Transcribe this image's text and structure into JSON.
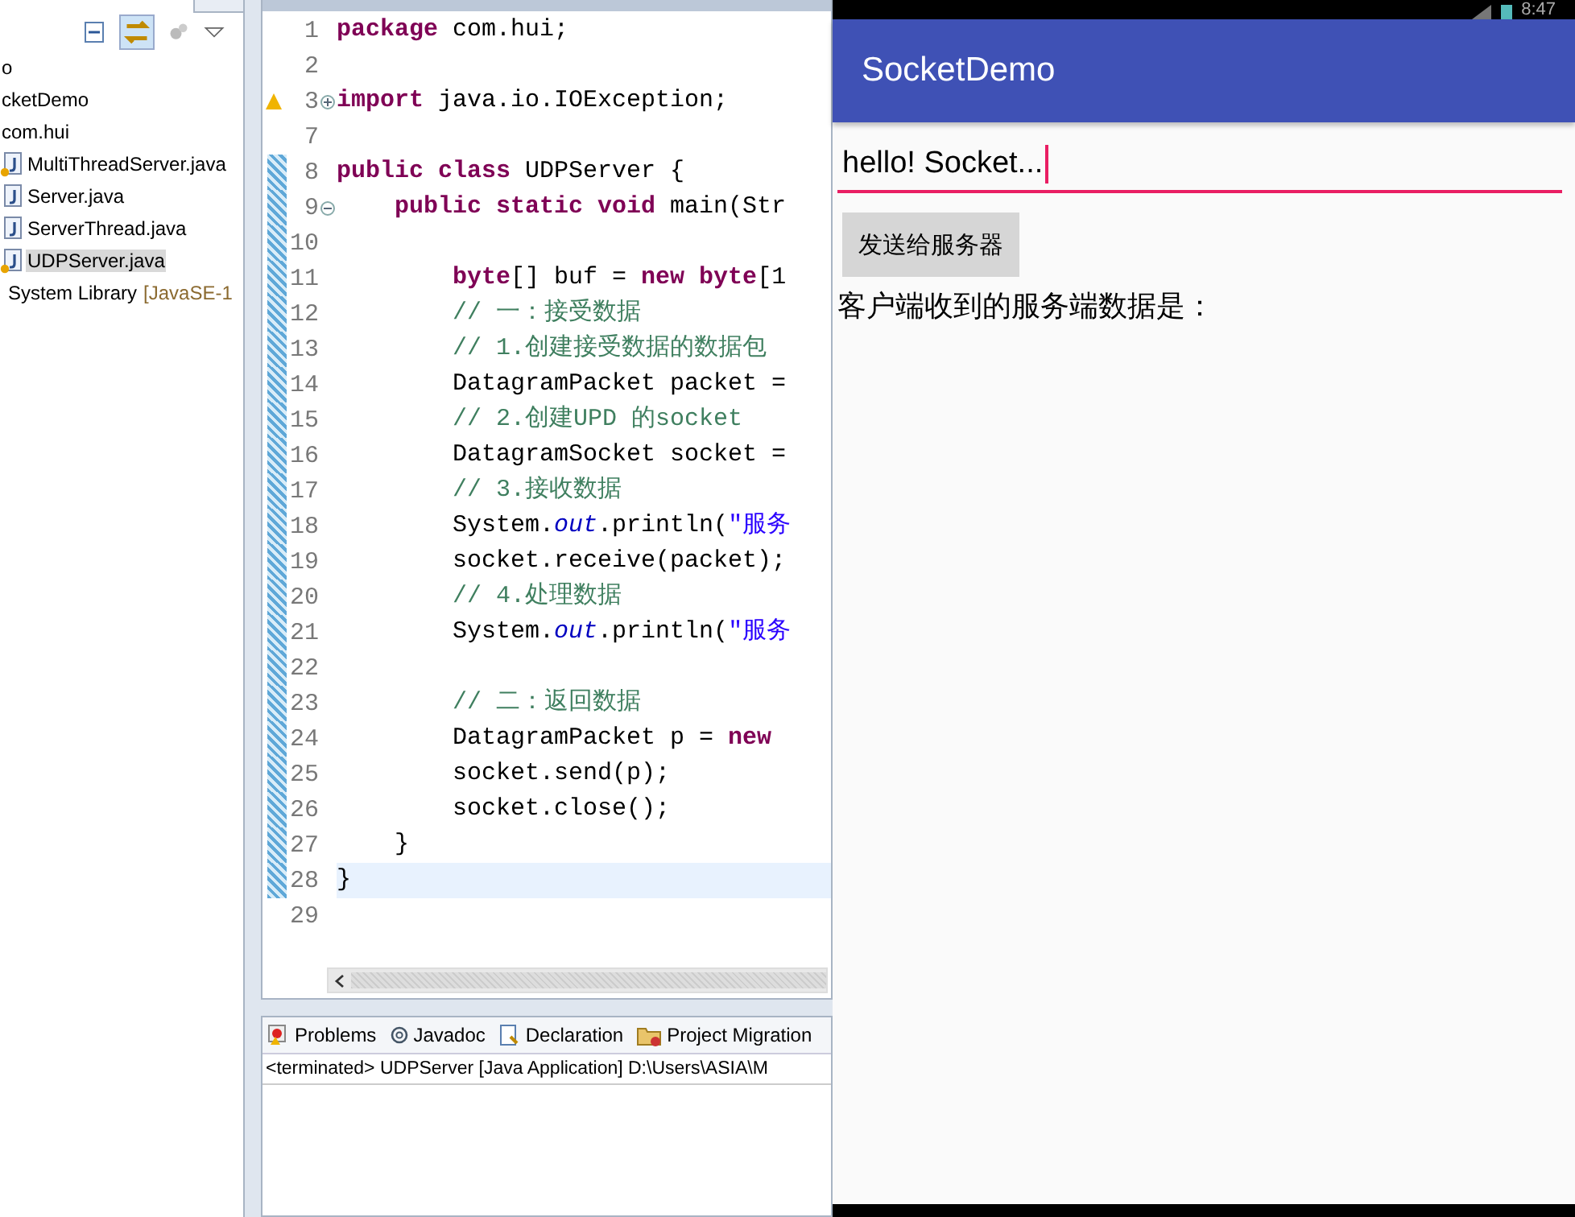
{
  "explorer": {
    "tree": [
      {
        "label": "o",
        "selected": false
      },
      {
        "label": "cketDemo",
        "selected": false,
        "children": [
          {
            "label": "com.hui",
            "selected": false,
            "children": [
              {
                "label": "MultiThreadServer.java",
                "kind": "file",
                "warning": true,
                "selected": false
              },
              {
                "label": "Server.java",
                "kind": "file",
                "warning": false,
                "selected": false
              },
              {
                "label": "ServerThread.java",
                "kind": "file",
                "warning": false,
                "selected": false
              },
              {
                "label": "UDPServer.java",
                "kind": "file",
                "warning": true,
                "selected": true
              }
            ]
          },
          {
            "label": "System Library",
            "kind": "library",
            "suffix": "[JavaSE-1",
            "selected": false
          }
        ]
      }
    ]
  },
  "editor": {
    "lines": [
      {
        "n": "1",
        "changed": false,
        "t": [
          {
            "kind": "keyword",
            "text": "package"
          },
          {
            "kind": "plain",
            "text": " com.hui;"
          }
        ]
      },
      {
        "n": "2",
        "changed": false
      },
      {
        "n": "3",
        "changed": false,
        "expanded": false,
        "warning": true,
        "t": [
          {
            "kind": "keyword",
            "text": "import"
          },
          {
            "kind": "plain",
            "text": " java.io.IOException;"
          }
        ]
      },
      {
        "n": "7",
        "changed": false
      },
      {
        "n": "8",
        "changed": true,
        "t": [
          {
            "kind": "keyword",
            "text": "public class"
          },
          {
            "kind": "plain",
            "text": " UDPServer {"
          }
        ]
      },
      {
        "n": "9",
        "changed": true,
        "expanded": true,
        "t": [
          {
            "kind": "keyword",
            "text": "    public static void"
          },
          {
            "kind": "plain",
            "text": " main(Str"
          }
        ]
      },
      {
        "n": "10",
        "changed": true
      },
      {
        "n": "11",
        "changed": true,
        "t": [
          {
            "kind": "keyword",
            "text": "        byte"
          },
          {
            "kind": "plain",
            "text": "[] buf = "
          },
          {
            "kind": "keyword",
            "text": "new byte"
          },
          {
            "kind": "plain",
            "text": "[1"
          }
        ]
      },
      {
        "n": "12",
        "changed": true,
        "t": [
          {
            "kind": "comment",
            "text": "        // 一：接受数据"
          }
        ]
      },
      {
        "n": "13",
        "changed": true,
        "t": [
          {
            "kind": "comment",
            "text": "        // 1.创建接受数据的数据包"
          }
        ]
      },
      {
        "n": "14",
        "changed": true,
        "t": [
          {
            "kind": "plain",
            "text": "        DatagramPacket packet ="
          }
        ]
      },
      {
        "n": "15",
        "changed": true,
        "t": [
          {
            "kind": "comment",
            "text": "        // 2.创建UPD 的socket"
          }
        ]
      },
      {
        "n": "16",
        "changed": true,
        "t": [
          {
            "kind": "plain",
            "text": "        DatagramSocket socket ="
          }
        ]
      },
      {
        "n": "17",
        "changed": true,
        "t": [
          {
            "kind": "comment",
            "text": "        // 3.接收数据"
          }
        ]
      },
      {
        "n": "18",
        "changed": true,
        "t": [
          {
            "kind": "plain",
            "text": "        System."
          },
          {
            "kind": "field",
            "text": "out"
          },
          {
            "kind": "plain",
            "text": ".println("
          },
          {
            "kind": "string",
            "text": "\"服务"
          }
        ]
      },
      {
        "n": "19",
        "changed": true,
        "t": [
          {
            "kind": "plain",
            "text": "        socket.receive(packet);"
          }
        ]
      },
      {
        "n": "20",
        "changed": true,
        "t": [
          {
            "kind": "comment",
            "text": "        // 4.处理数据"
          }
        ]
      },
      {
        "n": "21",
        "changed": true,
        "t": [
          {
            "kind": "plain",
            "text": "        System."
          },
          {
            "kind": "field",
            "text": "out"
          },
          {
            "kind": "plain",
            "text": ".println("
          },
          {
            "kind": "string",
            "text": "\"服务"
          }
        ]
      },
      {
        "n": "22",
        "changed": true
      },
      {
        "n": "23",
        "changed": true,
        "t": [
          {
            "kind": "comment",
            "text": "        // 二：返回数据"
          }
        ]
      },
      {
        "n": "24",
        "changed": true,
        "t": [
          {
            "kind": "plain",
            "text": "        DatagramPacket p = "
          },
          {
            "kind": "keyword",
            "text": "new"
          }
        ]
      },
      {
        "n": "25",
        "changed": true,
        "t": [
          {
            "kind": "plain",
            "text": "        socket.send(p);"
          }
        ]
      },
      {
        "n": "26",
        "changed": true,
        "t": [
          {
            "kind": "plain",
            "text": "        socket.close();"
          }
        ]
      },
      {
        "n": "27",
        "changed": true,
        "t": [
          {
            "kind": "plain",
            "text": "    }"
          }
        ]
      },
      {
        "n": "28",
        "changed": true,
        "current": true,
        "t": [
          {
            "kind": "plain",
            "text": "}"
          }
        ]
      },
      {
        "n": "29",
        "changed": false
      }
    ]
  },
  "bottom_panel": {
    "tabs": [
      {
        "label": "Problems",
        "selected": false
      },
      {
        "label": "Javadoc",
        "selected": false
      },
      {
        "label": "Declaration",
        "selected": false
      },
      {
        "label": "Project Migration",
        "selected": false
      }
    ],
    "console": "<terminated> UDPServer [Java Application] D:\\Users\\ASIA\\M"
  },
  "phone": {
    "time": "8:47",
    "title": "SocketDemo",
    "input": {
      "value": "hello! Socket..."
    },
    "button": "发送给服务器",
    "result": "客户端收到的服务端数据是："
  }
}
